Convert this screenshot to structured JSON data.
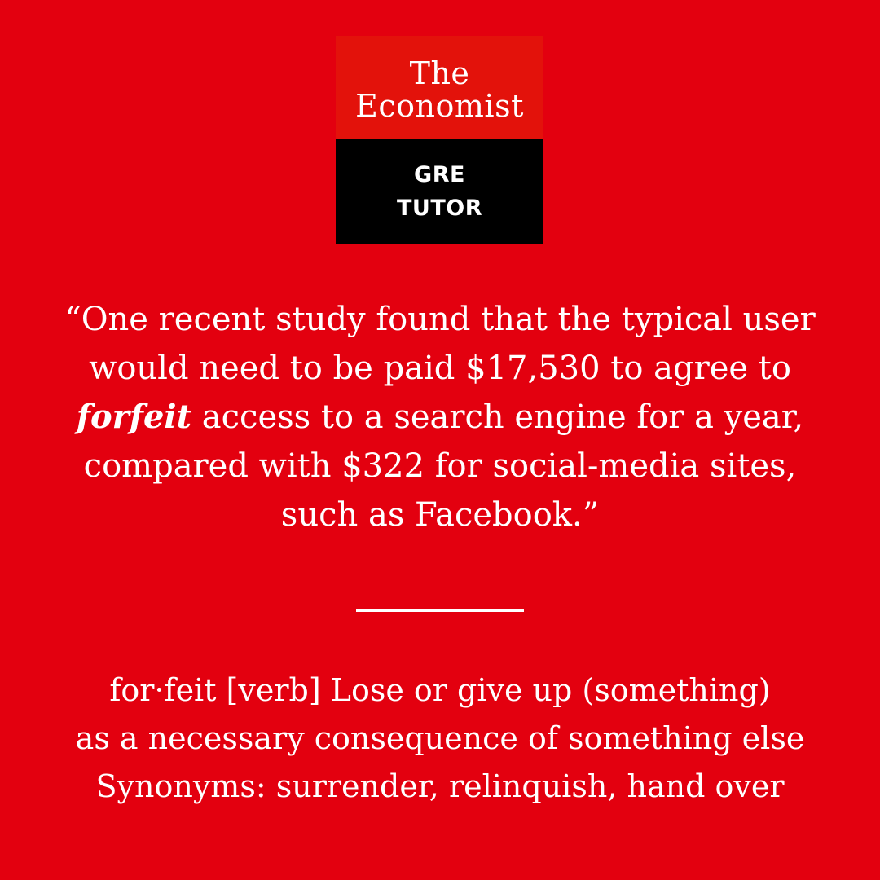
{
  "logo": {
    "line1": "The",
    "line2": "Economist",
    "badge_line1": "GRE",
    "badge_line2": "TUTOR"
  },
  "quote": {
    "before": "“One recent study found that the typical user would need to be paid $17,530 to agree to ",
    "highlight": "forfeit",
    "after": " access to a search engine for a year, compared with $322 for social-media sites, such as Facebook.”"
  },
  "definition": {
    "line1": "for·feit [verb] Lose or give up (something)",
    "line2": "as a necessary consequence of something else",
    "line3": "Synonyms: surrender, relinquish, hand over"
  },
  "colors": {
    "background": "#e3000f",
    "logo_red": "#e3120b",
    "logo_black": "#000000",
    "text": "#ffffff"
  }
}
